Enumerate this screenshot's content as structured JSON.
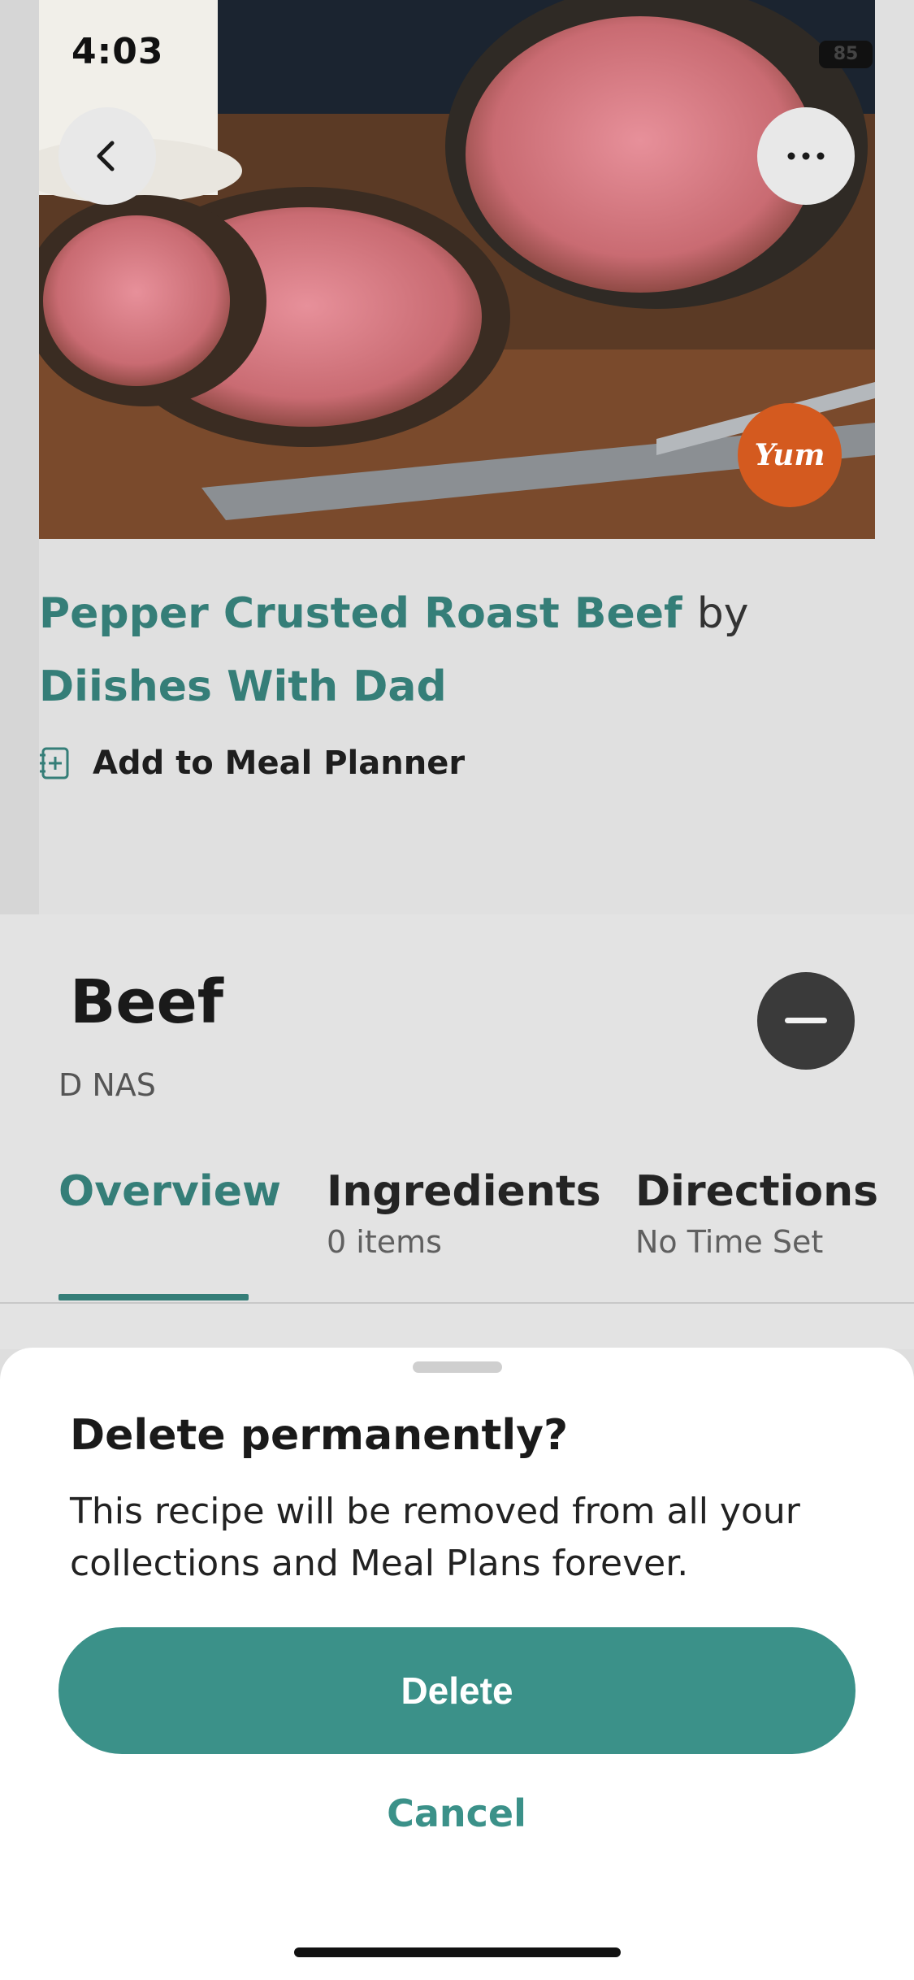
{
  "status_bar": {
    "time": "4:03",
    "battery": "85"
  },
  "hero": {
    "badge_text": "Yum"
  },
  "recipe": {
    "title": "Pepper Crusted Roast Beef",
    "by_word": "by",
    "author": "Diishes With Dad",
    "meal_planner_label": "Add to Meal Planner"
  },
  "collection": {
    "title": "Beef",
    "subtitle": "D NAS"
  },
  "tabs": [
    {
      "label": "Overview",
      "sub": ""
    },
    {
      "label": "Ingredients",
      "sub": "0 items"
    },
    {
      "label": "Directions",
      "sub": "No Time Set"
    }
  ],
  "sheet": {
    "title": "Delete permanently?",
    "message": "This recipe will be removed from all your collections and Meal Plans forever.",
    "delete_label": "Delete",
    "cancel_label": "Cancel"
  },
  "colors": {
    "accent": "#3b9189",
    "badge": "#d45a1f",
    "icon_dark": "#3a3a3a"
  },
  "icons": {
    "back": "chevron-left-icon",
    "more": "more-horizontal-icon",
    "planner": "calendar-plus-icon",
    "remove": "minus-icon"
  }
}
